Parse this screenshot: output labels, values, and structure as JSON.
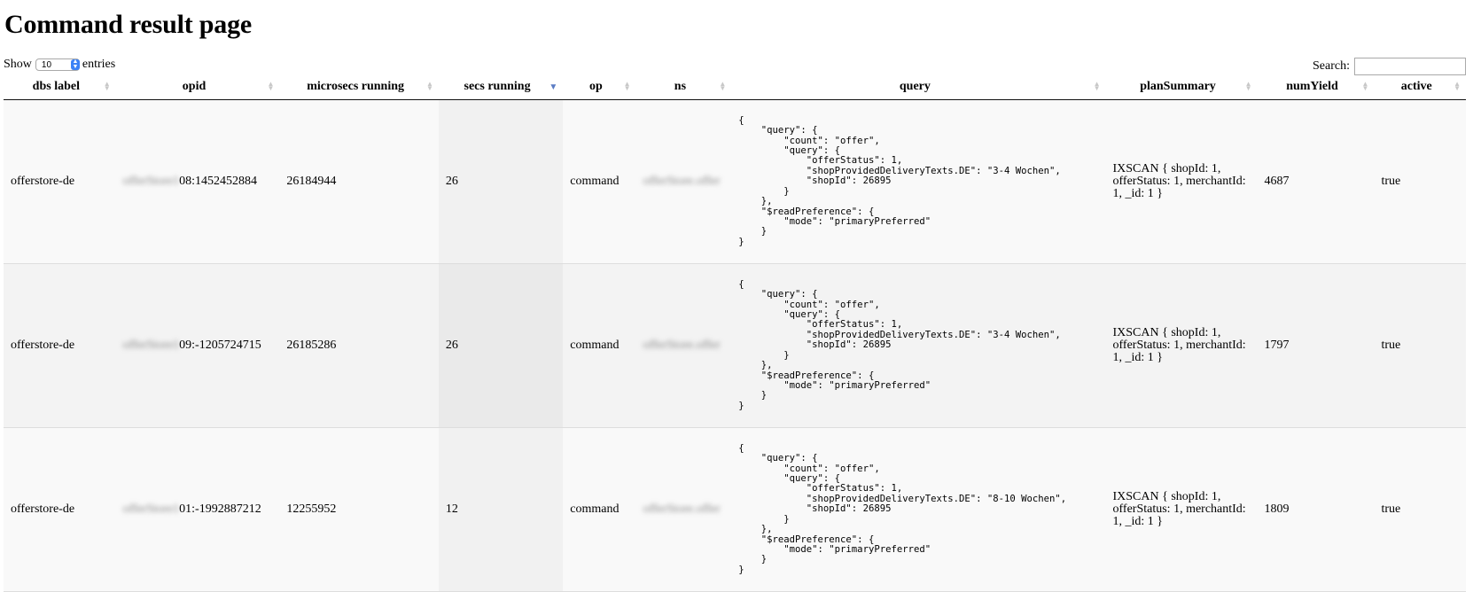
{
  "page": {
    "title": "Command result page"
  },
  "length": {
    "show_label": "Show",
    "entries_value": "10",
    "entries_label": "entries"
  },
  "search": {
    "label": "Search:",
    "value": ""
  },
  "columns": [
    "dbs label",
    "opid",
    "microsecs running",
    "secs running",
    "op",
    "ns",
    "query",
    "planSummary",
    "numYield",
    "active"
  ],
  "sorted_column": "secs running",
  "rows": [
    {
      "dbs_label": "offerstore-de",
      "opid_hidden": "offerStore1",
      "opid_visible": "08:1452452884",
      "microsecs": "26184944",
      "secs": "26",
      "op": "command",
      "ns": "offerStore.offer",
      "query": "{\n    \"query\": {\n        \"count\": \"offer\",\n        \"query\": {\n            \"offerStatus\": 1,\n            \"shopProvidedDeliveryTexts.DE\": \"3-4 Wochen\",\n            \"shopId\": 26895\n        }\n    },\n    \"$readPreference\": {\n        \"mode\": \"primaryPreferred\"\n    }\n}",
      "plan": "IXSCAN { shopId: 1, offerStatus: 1, merchantId: 1, _id: 1 }",
      "numYield": "4687",
      "active": "true"
    },
    {
      "dbs_label": "offerstore-de",
      "opid_hidden": "offerStore1",
      "opid_visible": "09:-1205724715",
      "microsecs": "26185286",
      "secs": "26",
      "op": "command",
      "ns": "offerStore.offer",
      "query": "{\n    \"query\": {\n        \"count\": \"offer\",\n        \"query\": {\n            \"offerStatus\": 1,\n            \"shopProvidedDeliveryTexts.DE\": \"3-4 Wochen\",\n            \"shopId\": 26895\n        }\n    },\n    \"$readPreference\": {\n        \"mode\": \"primaryPreferred\"\n    }\n}",
      "plan": "IXSCAN { shopId: 1, offerStatus: 1, merchantId: 1, _id: 1 }",
      "numYield": "1797",
      "active": "true"
    },
    {
      "dbs_label": "offerstore-de",
      "opid_hidden": "offerStore1",
      "opid_visible": "01:-1992887212",
      "microsecs": "12255952",
      "secs": "12",
      "op": "command",
      "ns": "offerStore.offer",
      "query": "{\n    \"query\": {\n        \"count\": \"offer\",\n        \"query\": {\n            \"offerStatus\": 1,\n            \"shopProvidedDeliveryTexts.DE\": \"8-10 Wochen\",\n            \"shopId\": 26895\n        }\n    },\n    \"$readPreference\": {\n        \"mode\": \"primaryPreferred\"\n    }\n}",
      "plan": "IXSCAN { shopId: 1, offerStatus: 1, merchantId: 1, _id: 1 }",
      "numYield": "1809",
      "active": "true"
    }
  ]
}
